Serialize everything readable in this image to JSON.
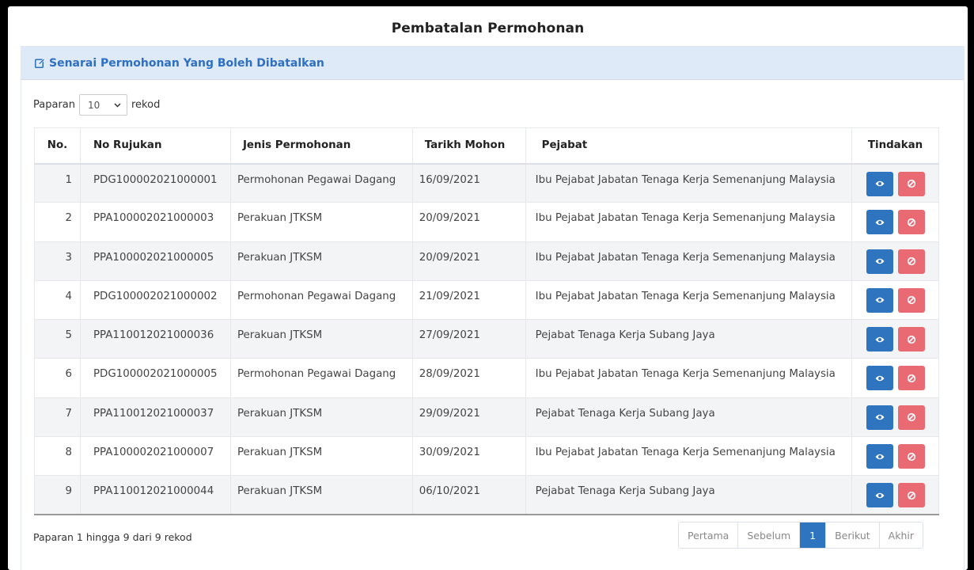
{
  "page": {
    "title": "Pembatalan Permohonan"
  },
  "panel": {
    "heading": "Senarai Permohonan Yang Boleh Dibatalkan",
    "heading_icon": "edit-icon"
  },
  "length": {
    "prefix": "Paparan",
    "selected": "10",
    "suffix": "rekod"
  },
  "table": {
    "headers": {
      "no": "No.",
      "ref": "No Rujukan",
      "jenis": "Jenis Permohonan",
      "tarikh": "Tarikh Mohon",
      "pejabat": "Pejabat",
      "tindakan": "Tindakan"
    },
    "rows": [
      {
        "no": "1",
        "ref": "PDG100002021000001",
        "jenis": "Permohonan Pegawai Dagang",
        "tarikh": "16/09/2021",
        "pejabat": "Ibu Pejabat Jabatan Tenaga Kerja Semenanjung Malaysia"
      },
      {
        "no": "2",
        "ref": "PPA100002021000003",
        "jenis": "Perakuan JTKSM",
        "tarikh": "20/09/2021",
        "pejabat": "Ibu Pejabat Jabatan Tenaga Kerja Semenanjung Malaysia"
      },
      {
        "no": "3",
        "ref": "PPA100002021000005",
        "jenis": "Perakuan JTKSM",
        "tarikh": "20/09/2021",
        "pejabat": "Ibu Pejabat Jabatan Tenaga Kerja Semenanjung Malaysia"
      },
      {
        "no": "4",
        "ref": "PDG100002021000002",
        "jenis": "Permohonan Pegawai Dagang",
        "tarikh": "21/09/2021",
        "pejabat": "Ibu Pejabat Jabatan Tenaga Kerja Semenanjung Malaysia"
      },
      {
        "no": "5",
        "ref": "PPA110012021000036",
        "jenis": "Perakuan JTKSM",
        "tarikh": "27/09/2021",
        "pejabat": "Pejabat Tenaga Kerja Subang Jaya"
      },
      {
        "no": "6",
        "ref": "PDG100002021000005",
        "jenis": "Permohonan Pegawai Dagang",
        "tarikh": "28/09/2021",
        "pejabat": "Ibu Pejabat Jabatan Tenaga Kerja Semenanjung Malaysia"
      },
      {
        "no": "7",
        "ref": "PPA110012021000037",
        "jenis": "Perakuan JTKSM",
        "tarikh": "29/09/2021",
        "pejabat": "Pejabat Tenaga Kerja Subang Jaya"
      },
      {
        "no": "8",
        "ref": "PPA100002021000007",
        "jenis": "Perakuan JTKSM",
        "tarikh": "30/09/2021",
        "pejabat": "Ibu Pejabat Jabatan Tenaga Kerja Semenanjung Malaysia"
      },
      {
        "no": "9",
        "ref": "PPA110012021000044",
        "jenis": "Perakuan JTKSM",
        "tarikh": "06/10/2021",
        "pejabat": "Pejabat Tenaga Kerja Subang Jaya"
      }
    ],
    "actions": {
      "view_icon": "eye-icon",
      "cancel_icon": "ban-icon"
    }
  },
  "footer": {
    "info": "Paparan 1 hingga 9 dari 9 rekod",
    "pager": {
      "first": "Pertama",
      "prev": "Sebelum",
      "current": "1",
      "next": "Berikut",
      "last": "Akhir"
    }
  },
  "colors": {
    "primary": "#2f74be",
    "danger": "#ea6a74",
    "heading_bg": "#dfeaf8",
    "heading_text": "#2e6fc4"
  }
}
